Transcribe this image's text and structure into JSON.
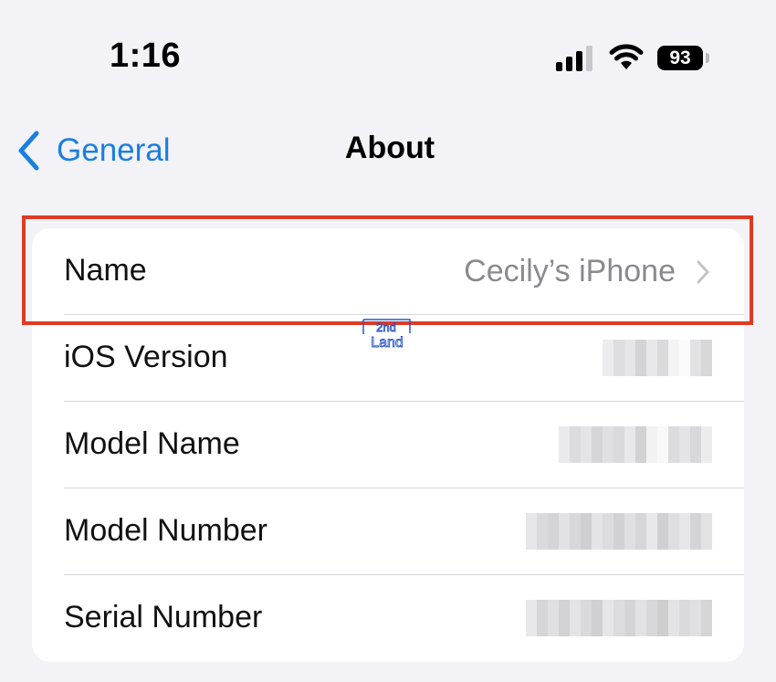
{
  "status_bar": {
    "time": "1:16",
    "battery_level": "93",
    "signal_bars_filled": 3,
    "signal_bars_total": 4
  },
  "nav": {
    "back_label": "General",
    "title": "About"
  },
  "rows": [
    {
      "label": "Name",
      "value": "Cecily’s iPhone",
      "has_chevron": true
    },
    {
      "label": "iOS Version",
      "value": "",
      "obscured": true
    },
    {
      "label": "Model Name",
      "value": "",
      "obscured": true
    },
    {
      "label": "Model Number",
      "value": "",
      "obscured": true
    },
    {
      "label": "Serial Number",
      "value": "",
      "obscured": true
    }
  ],
  "watermark": {
    "line1": "2nd",
    "line2": "Land"
  },
  "colors": {
    "accent": "#1a7ee0",
    "highlight": "#e03a24",
    "background": "#f2f2f7",
    "secondary_text": "#8a8a8e",
    "watermark": "#2a55c8"
  },
  "icons": [
    "signal-icon",
    "wifi-icon",
    "battery-icon",
    "back-chevron-icon",
    "chevron-right-icon"
  ]
}
